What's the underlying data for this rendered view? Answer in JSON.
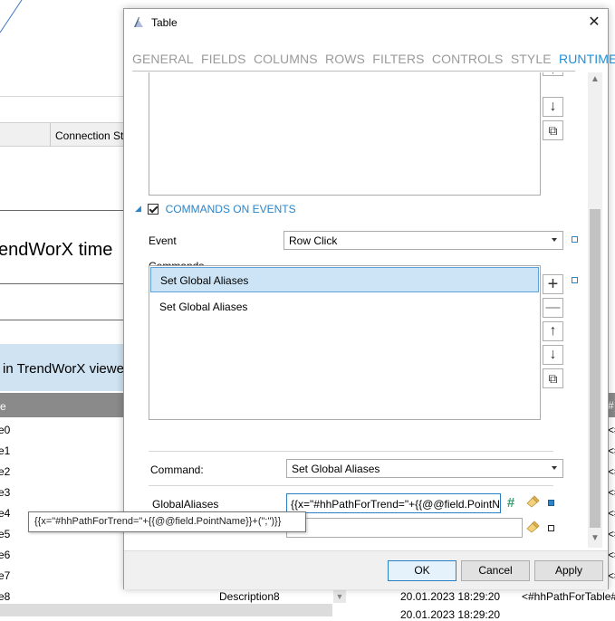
{
  "background": {
    "grid_header_label": "Connection Sta",
    "big_text": "endWorX time",
    "banner_text": "in TrendWorX viewe",
    "left_header": "e",
    "left_rows": [
      "e0",
      "e1",
      "e2",
      "e3",
      "e4",
      "e5",
      "e6",
      "e7",
      "e8"
    ],
    "right_header": "#",
    "right_rows": [
      "<#",
      "<#",
      "<#",
      "<#",
      "<#",
      "<#",
      "<#",
      "<#"
    ],
    "bottom_desc": "Description8",
    "bottom_date": "20.01.2023 18:29:20",
    "bottom_path": "<#hhPathForTable#",
    "bottom_date2": "20.01.2023 18:29:20",
    "scroll_down_glyph": "▼"
  },
  "dialog": {
    "title": "Table",
    "close_glyph": "✕",
    "tabs": [
      {
        "label": "GENERAL"
      },
      {
        "label": "FIELDS"
      },
      {
        "label": "COLUMNS"
      },
      {
        "label": "ROWS"
      },
      {
        "label": "FILTERS"
      },
      {
        "label": "CONTROLS"
      },
      {
        "label": "STYLE"
      },
      {
        "label": "RUNTIME"
      }
    ],
    "active_tab": "RUNTIME",
    "commands_on_events": {
      "label": "COMMANDS ON EVENTS",
      "checked": true,
      "event_label": "Event",
      "event_value": "Row Click",
      "commands_label": "Commands",
      "commands": [
        "Set Global Aliases",
        "Set Global Aliases"
      ],
      "selected_index": 0
    },
    "command_label": "Command:",
    "command_value": "Set Global Aliases",
    "global_aliases_label": "GlobalAliases",
    "global_aliases_value": "{{x=\"#hhPathForTrend=\"+{{@@field.PointN",
    "tooltip": "{{x=\"#hhPathForTrend=\"+{{@@field.PointName}}+(\";\")}}",
    "buttons": {
      "ok": "OK",
      "cancel": "Cancel",
      "apply": "Apply"
    },
    "side_button_glyphs": {
      "add": "+",
      "remove": "—",
      "up": "↑",
      "down": "↓",
      "copy": "⧉"
    },
    "hash_glyph": "#",
    "scroll_up_glyph": "▲",
    "scroll_down_glyph": "▼"
  },
  "colors": {
    "accent": "#1e90d8",
    "section_blue": "#2b85c7",
    "selection": "#cce4f5"
  }
}
